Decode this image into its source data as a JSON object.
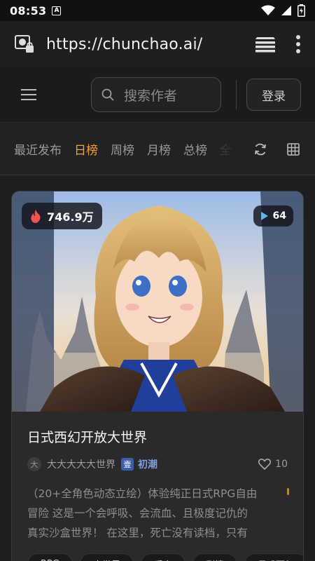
{
  "status_bar": {
    "time": "08:53",
    "notification_letter": "A"
  },
  "browser": {
    "url": "https://chunchao.ai/"
  },
  "header": {
    "search_placeholder": "搜索作者",
    "login_label": "登录"
  },
  "tabs": [
    "最近发布",
    "日榜",
    "周榜",
    "月榜",
    "总榜",
    "全"
  ],
  "active_tab": "日榜",
  "card": {
    "hot_count": "746.9万",
    "image_count": "64",
    "title": "日式西幻开放大世界",
    "author_initial": "大",
    "author_name": "大大大大大世界",
    "brand_badge": "壹",
    "brand_name": "初潮",
    "likes": "10",
    "description_lines": [
      "（20+全角色动态立绘）体验纯正日式RPG自由",
      "冒险 这是一个会呼吸、会流血、且极度记仇的",
      "真实沙盒世界！ 在这里，死亡没有读档，只有"
    ],
    "tags": [
      "RPG",
      "大世界",
      "后宫",
      "剧情",
      "日式西幻"
    ]
  },
  "colors": {
    "accent": "#f2a33a",
    "background": "#1e1e1e",
    "card": "#2a2a2a",
    "brand": "#3b5fa8"
  }
}
